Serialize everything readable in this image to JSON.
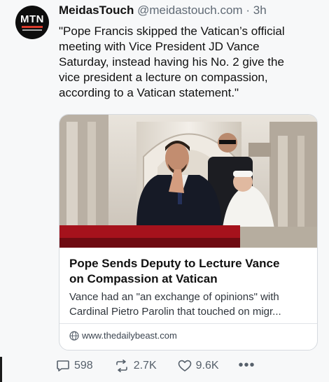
{
  "post": {
    "author": "MeidasTouch",
    "handle": "@meidastouch.com",
    "separator": "·",
    "time": "3h",
    "avatar_text": "MTN",
    "text_lines": [
      "\"Pope Francis skipped the Vatican’s official",
      "meeting with Vice President JD Vance",
      "Saturday, instead having his No. 2 give the",
      "vice president a lecture on compassion,",
      "according to a Vatican statement.\""
    ]
  },
  "card": {
    "title_lines": [
      "Pope Sends Deputy to Lecture Vance",
      "on Compassion at Vatican"
    ],
    "description_lines": [
      "Vance had an \"an exchange of opinions\" with",
      "Cardinal Pietro Parolin that touched on migr..."
    ],
    "domain": "www.thedailybeast.com"
  },
  "actions": {
    "replies": "598",
    "reposts": "2.7K",
    "likes": "9.6K",
    "more_label": "•••"
  },
  "colors": {
    "background": "#f7f8f9",
    "text": "#111111",
    "muted": "#606a75",
    "border": "#d6dadf"
  }
}
